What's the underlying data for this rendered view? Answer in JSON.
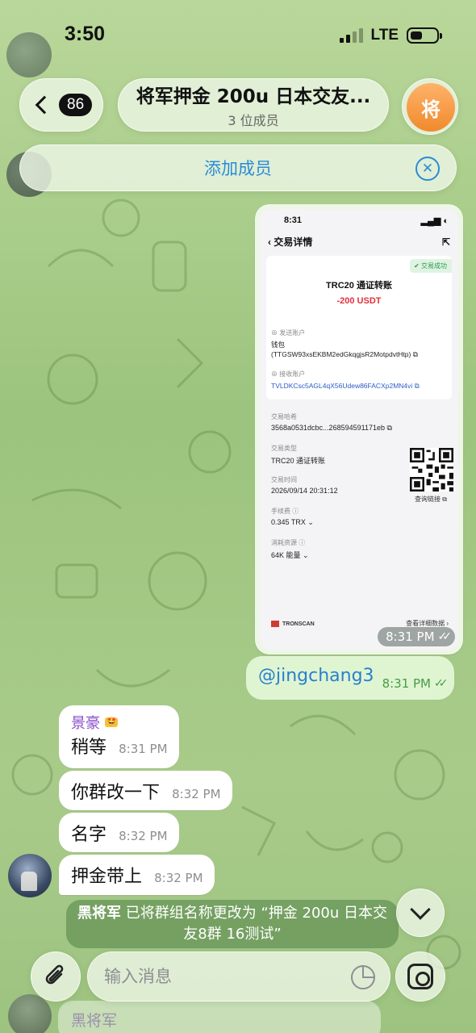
{
  "status_bar": {
    "time": "3:50",
    "network": "LTE"
  },
  "header": {
    "unread_count": "86",
    "title": "将军押金 200u 日本交友...",
    "subtitle": "3 位成员",
    "avatar_letter": "将",
    "add_member_label": "添加成员"
  },
  "image_message": {
    "time": "8:31 PM",
    "screenshot": {
      "status_time": "8:31",
      "nav_title": "交易详情",
      "success_badge": "交易成功",
      "transfer_type_title": "TRC20 通证转账",
      "amount": "-200 USDT",
      "sender_label": "发送账户",
      "sender_name": "钱包",
      "sender_address": "(TTGSW93xsEKBM2edGkqgjsR2MotpdvtHtp)",
      "receiver_label": "接收账户",
      "receiver_address": "TVLDKCsc5AGL4qX56Udew86FACXp2MN4vi",
      "hash_label": "交易哈希",
      "hash_value": "3568a0531dcbc...268594591171eb",
      "type_label": "交易类型",
      "type_value": "TRC20 通证转账",
      "time_label": "交易时间",
      "time_value": "2026/09/14 20:31:12",
      "fee_label": "手续费",
      "fee_value": "0.345 TRX",
      "resource_label": "消耗资源",
      "resource_value": "64K 能量",
      "qr_caption": "查询链接",
      "brand": "TRONSCAN",
      "detail_link": "查看详细数据"
    }
  },
  "outgoing_message": {
    "text": "@jingchang3",
    "time": "8:31 PM"
  },
  "incoming_messages": [
    {
      "sender": "景豪",
      "sender_badge": "🤩",
      "text": "稍等",
      "time": "8:31 PM"
    },
    {
      "text": "你群改一下",
      "time": "8:32 PM"
    },
    {
      "text": "名字",
      "time": "8:32 PM"
    },
    {
      "text": "押金带上",
      "time": "8:32 PM"
    }
  ],
  "service_message": {
    "actor": "黑将军",
    "text": " 已将群组名称更改为 “押金 200u 日本交友8群 16测试”"
  },
  "composer": {
    "placeholder": "输入消息"
  },
  "bottom_preview": {
    "sender": "黑将军"
  }
}
